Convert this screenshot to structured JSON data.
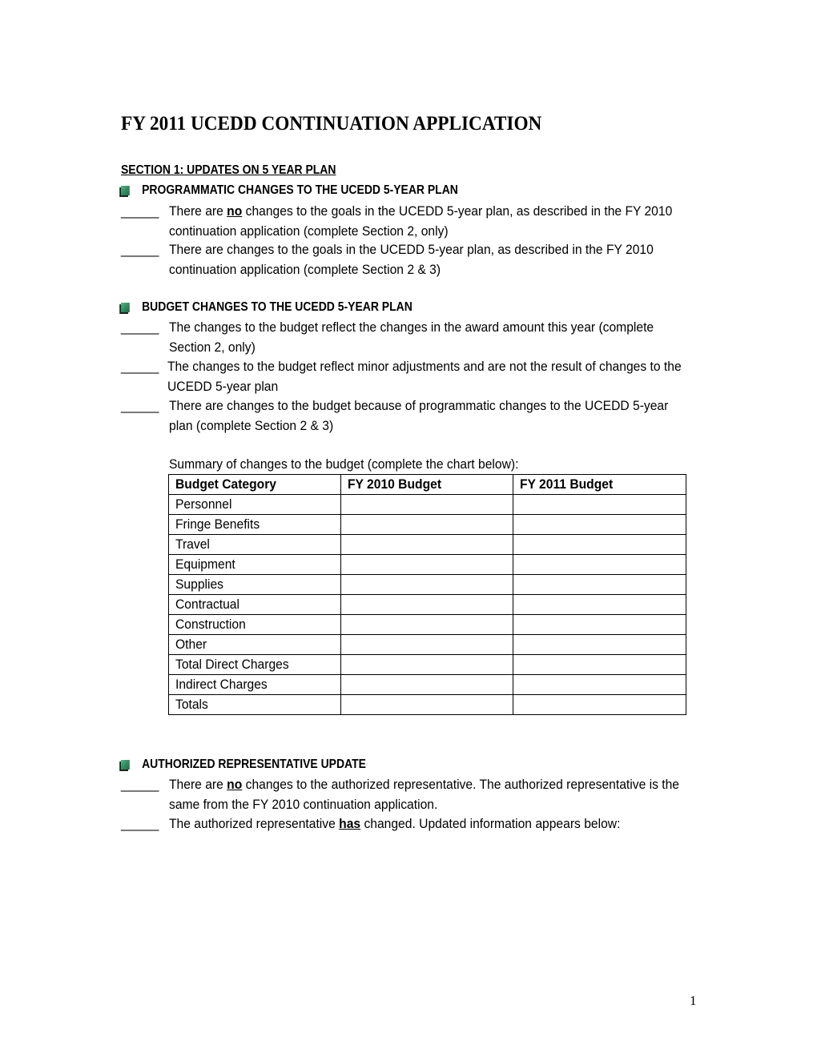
{
  "document": {
    "title": "FY 2011 UCEDD CONTINUATION APPLICATION",
    "section_heading": "SECTION 1: UPDATES ON 5 YEAR PLAN",
    "blank_line": "_____",
    "programmatic": {
      "heading": "PROGRAMMATIC CHANGES TO THE UCEDD 5-YEAR PLAN",
      "options": [
        {
          "pre": "There are ",
          "emph": "no",
          "post": " changes to the goals in the UCEDD 5-year plan, as described in the FY 2010 continuation application (complete Section 2, only)"
        },
        {
          "text": "There are changes to the goals in the UCEDD 5-year plan, as described in the FY 2010 continuation application (complete Section 2 & 3)"
        }
      ]
    },
    "budget": {
      "heading": "BUDGET CHANGES TO THE UCEDD 5-YEAR PLAN",
      "options": [
        {
          "text": "The changes to the budget reflect the changes in the award amount this year (complete Section 2, only)"
        },
        {
          "text": "The changes to the budget reflect minor adjustments and are not the result of changes to the UCEDD 5-year plan"
        },
        {
          "text": "There are changes to the budget because of programmatic changes to the UCEDD 5-year plan (complete Section 2 & 3)"
        }
      ],
      "summary_label": "Summary of changes to the budget (complete the chart below):",
      "table": {
        "headers": [
          "Budget Category",
          "FY 2010 Budget",
          "FY 2011 Budget"
        ],
        "rows": [
          [
            "Personnel",
            "",
            ""
          ],
          [
            "Fringe Benefits",
            "",
            ""
          ],
          [
            "Travel",
            "",
            ""
          ],
          [
            "Equipment",
            "",
            ""
          ],
          [
            "Supplies",
            "",
            ""
          ],
          [
            "Contractual",
            "",
            ""
          ],
          [
            "Construction",
            "",
            ""
          ],
          [
            "Other",
            "",
            ""
          ],
          [
            "Total Direct Charges",
            "",
            ""
          ],
          [
            "Indirect Charges",
            "",
            ""
          ],
          [
            "Totals",
            "",
            ""
          ]
        ]
      }
    },
    "authorized_rep": {
      "heading": "AUTHORIZED REPRESENTATIVE UPDATE",
      "options": [
        {
          "pre": "There are ",
          "emph": "no",
          "post": " changes to the authorized representative. The authorized representative is the same from the FY 2010 continuation application."
        },
        {
          "pre": "The authorized representative ",
          "emph": "has",
          "post": " changed. Updated information appears below:"
        }
      ]
    },
    "page_number": "1",
    "bullet_icon": "green-square-bullet-icon",
    "bullet_color": "#2e8a5e"
  }
}
